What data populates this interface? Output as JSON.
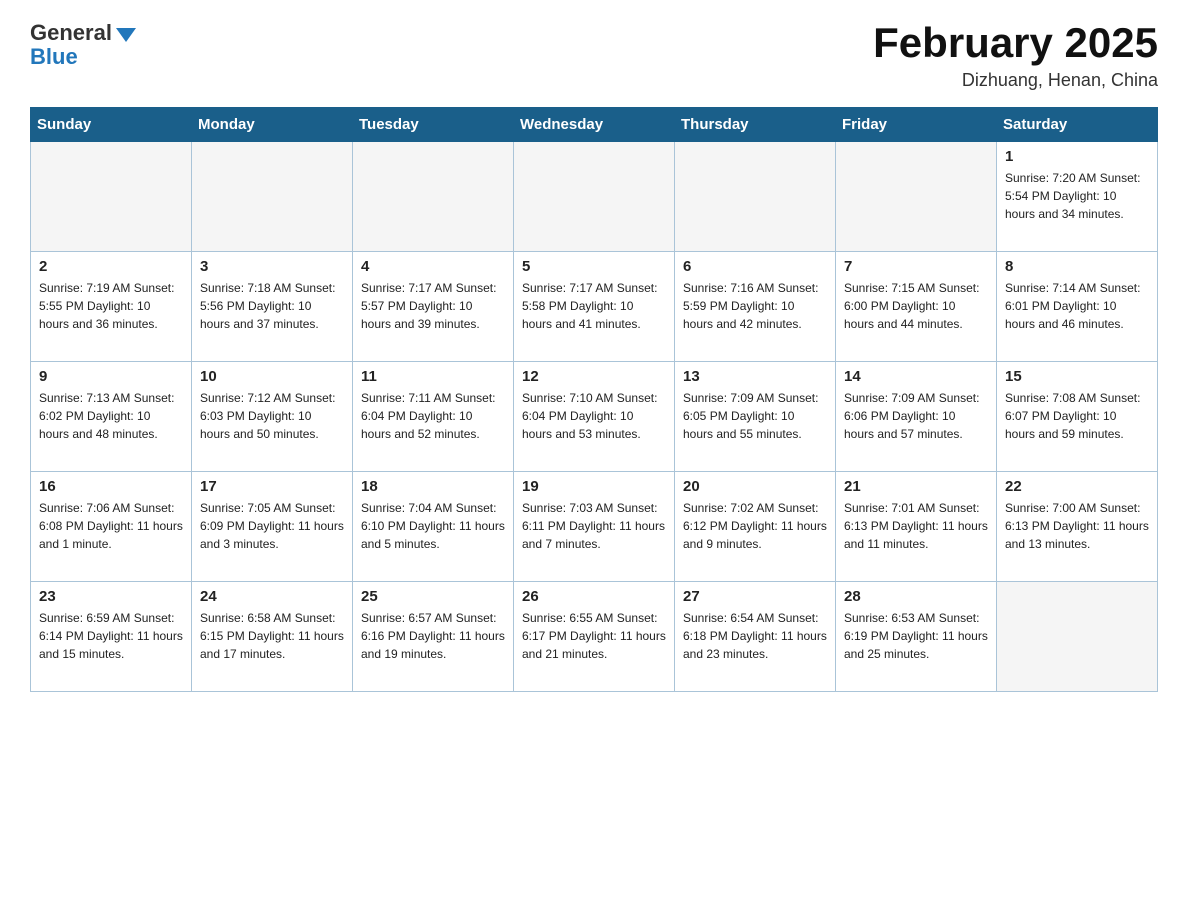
{
  "logo": {
    "general": "General",
    "blue": "Blue"
  },
  "title": "February 2025",
  "location": "Dizhuang, Henan, China",
  "weekdays": [
    "Sunday",
    "Monday",
    "Tuesday",
    "Wednesday",
    "Thursday",
    "Friday",
    "Saturday"
  ],
  "weeks": [
    [
      {
        "day": "",
        "info": "",
        "empty": true
      },
      {
        "day": "",
        "info": "",
        "empty": true
      },
      {
        "day": "",
        "info": "",
        "empty": true
      },
      {
        "day": "",
        "info": "",
        "empty": true
      },
      {
        "day": "",
        "info": "",
        "empty": true
      },
      {
        "day": "",
        "info": "",
        "empty": true
      },
      {
        "day": "1",
        "info": "Sunrise: 7:20 AM\nSunset: 5:54 PM\nDaylight: 10 hours and 34 minutes.",
        "empty": false
      }
    ],
    [
      {
        "day": "2",
        "info": "Sunrise: 7:19 AM\nSunset: 5:55 PM\nDaylight: 10 hours and 36 minutes.",
        "empty": false
      },
      {
        "day": "3",
        "info": "Sunrise: 7:18 AM\nSunset: 5:56 PM\nDaylight: 10 hours and 37 minutes.",
        "empty": false
      },
      {
        "day": "4",
        "info": "Sunrise: 7:17 AM\nSunset: 5:57 PM\nDaylight: 10 hours and 39 minutes.",
        "empty": false
      },
      {
        "day": "5",
        "info": "Sunrise: 7:17 AM\nSunset: 5:58 PM\nDaylight: 10 hours and 41 minutes.",
        "empty": false
      },
      {
        "day": "6",
        "info": "Sunrise: 7:16 AM\nSunset: 5:59 PM\nDaylight: 10 hours and 42 minutes.",
        "empty": false
      },
      {
        "day": "7",
        "info": "Sunrise: 7:15 AM\nSunset: 6:00 PM\nDaylight: 10 hours and 44 minutes.",
        "empty": false
      },
      {
        "day": "8",
        "info": "Sunrise: 7:14 AM\nSunset: 6:01 PM\nDaylight: 10 hours and 46 minutes.",
        "empty": false
      }
    ],
    [
      {
        "day": "9",
        "info": "Sunrise: 7:13 AM\nSunset: 6:02 PM\nDaylight: 10 hours and 48 minutes.",
        "empty": false
      },
      {
        "day": "10",
        "info": "Sunrise: 7:12 AM\nSunset: 6:03 PM\nDaylight: 10 hours and 50 minutes.",
        "empty": false
      },
      {
        "day": "11",
        "info": "Sunrise: 7:11 AM\nSunset: 6:04 PM\nDaylight: 10 hours and 52 minutes.",
        "empty": false
      },
      {
        "day": "12",
        "info": "Sunrise: 7:10 AM\nSunset: 6:04 PM\nDaylight: 10 hours and 53 minutes.",
        "empty": false
      },
      {
        "day": "13",
        "info": "Sunrise: 7:09 AM\nSunset: 6:05 PM\nDaylight: 10 hours and 55 minutes.",
        "empty": false
      },
      {
        "day": "14",
        "info": "Sunrise: 7:09 AM\nSunset: 6:06 PM\nDaylight: 10 hours and 57 minutes.",
        "empty": false
      },
      {
        "day": "15",
        "info": "Sunrise: 7:08 AM\nSunset: 6:07 PM\nDaylight: 10 hours and 59 minutes.",
        "empty": false
      }
    ],
    [
      {
        "day": "16",
        "info": "Sunrise: 7:06 AM\nSunset: 6:08 PM\nDaylight: 11 hours and 1 minute.",
        "empty": false
      },
      {
        "day": "17",
        "info": "Sunrise: 7:05 AM\nSunset: 6:09 PM\nDaylight: 11 hours and 3 minutes.",
        "empty": false
      },
      {
        "day": "18",
        "info": "Sunrise: 7:04 AM\nSunset: 6:10 PM\nDaylight: 11 hours and 5 minutes.",
        "empty": false
      },
      {
        "day": "19",
        "info": "Sunrise: 7:03 AM\nSunset: 6:11 PM\nDaylight: 11 hours and 7 minutes.",
        "empty": false
      },
      {
        "day": "20",
        "info": "Sunrise: 7:02 AM\nSunset: 6:12 PM\nDaylight: 11 hours and 9 minutes.",
        "empty": false
      },
      {
        "day": "21",
        "info": "Sunrise: 7:01 AM\nSunset: 6:13 PM\nDaylight: 11 hours and 11 minutes.",
        "empty": false
      },
      {
        "day": "22",
        "info": "Sunrise: 7:00 AM\nSunset: 6:13 PM\nDaylight: 11 hours and 13 minutes.",
        "empty": false
      }
    ],
    [
      {
        "day": "23",
        "info": "Sunrise: 6:59 AM\nSunset: 6:14 PM\nDaylight: 11 hours and 15 minutes.",
        "empty": false
      },
      {
        "day": "24",
        "info": "Sunrise: 6:58 AM\nSunset: 6:15 PM\nDaylight: 11 hours and 17 minutes.",
        "empty": false
      },
      {
        "day": "25",
        "info": "Sunrise: 6:57 AM\nSunset: 6:16 PM\nDaylight: 11 hours and 19 minutes.",
        "empty": false
      },
      {
        "day": "26",
        "info": "Sunrise: 6:55 AM\nSunset: 6:17 PM\nDaylight: 11 hours and 21 minutes.",
        "empty": false
      },
      {
        "day": "27",
        "info": "Sunrise: 6:54 AM\nSunset: 6:18 PM\nDaylight: 11 hours and 23 minutes.",
        "empty": false
      },
      {
        "day": "28",
        "info": "Sunrise: 6:53 AM\nSunset: 6:19 PM\nDaylight: 11 hours and 25 minutes.",
        "empty": false
      },
      {
        "day": "",
        "info": "",
        "empty": true
      }
    ]
  ]
}
